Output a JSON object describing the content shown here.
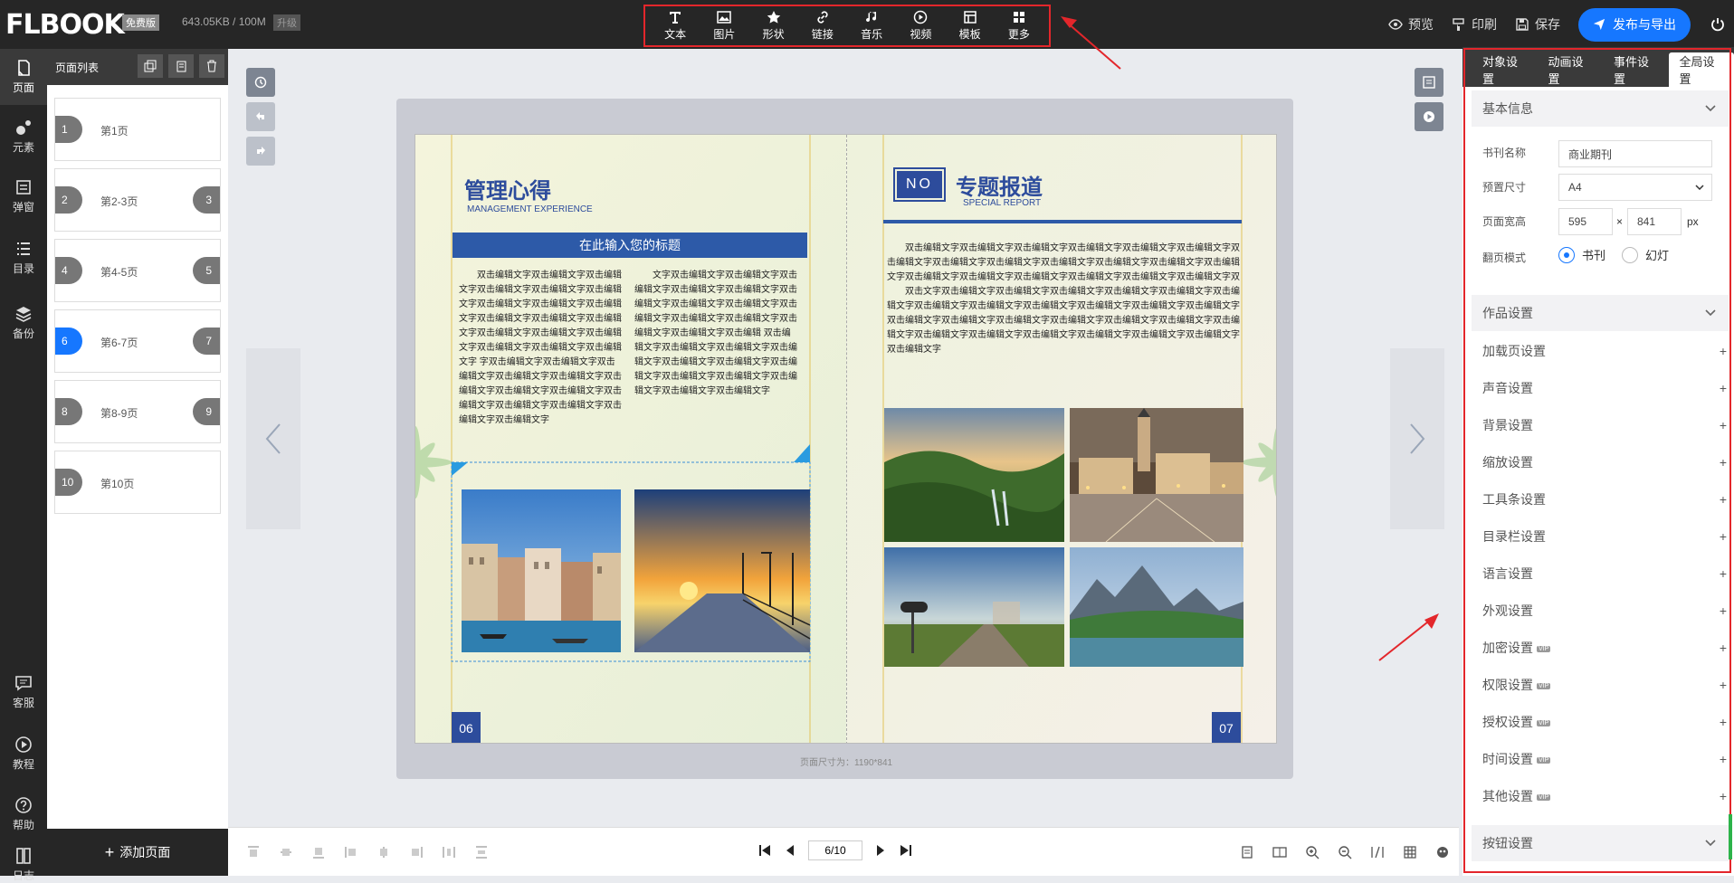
{
  "header": {
    "logo": "FLBOOK",
    "logo_mark": "®",
    "plan_badge": "免费版",
    "storage": "643.05KB / 100M",
    "upgrade": "升级",
    "tools": [
      {
        "label": "文本",
        "icon": "text-icon"
      },
      {
        "label": "图片",
        "icon": "image-icon"
      },
      {
        "label": "形状",
        "icon": "star-icon"
      },
      {
        "label": "链接",
        "icon": "link-icon"
      },
      {
        "label": "音乐",
        "icon": "music-icon"
      },
      {
        "label": "视频",
        "icon": "video-icon"
      },
      {
        "label": "模板",
        "icon": "template-icon"
      },
      {
        "label": "更多",
        "icon": "more-icon"
      }
    ],
    "preview": "预览",
    "print": "印刷",
    "save": "保存",
    "publish": "发布与导出"
  },
  "leftnav": {
    "items": [
      {
        "label": "页面",
        "icon": "page-icon"
      },
      {
        "label": "元素",
        "icon": "elements-icon"
      },
      {
        "label": "弹窗",
        "icon": "popup-icon"
      },
      {
        "label": "目录",
        "icon": "toc-icon"
      },
      {
        "label": "备份",
        "icon": "layers-icon"
      }
    ],
    "bottom": [
      {
        "label": "客服",
        "icon": "chat-icon"
      },
      {
        "label": "教程",
        "icon": "play-icon"
      },
      {
        "label": "帮助",
        "icon": "help-icon"
      },
      {
        "label": "日志",
        "icon": "log-icon"
      }
    ]
  },
  "pagelist": {
    "title": "页面列表",
    "pages": [
      {
        "num": "1",
        "label": "第1页",
        "right": ""
      },
      {
        "num": "2",
        "label": "第2-3页",
        "right": "3"
      },
      {
        "num": "4",
        "label": "第4-5页",
        "right": "5"
      },
      {
        "num": "6",
        "label": "第6-7页",
        "right": "7",
        "active": true
      },
      {
        "num": "8",
        "label": "第8-9页",
        "right": "9"
      },
      {
        "num": "10",
        "label": "第10页",
        "right": ""
      }
    ],
    "add_page": "添加页面"
  },
  "book": {
    "left": {
      "title": "管理心得",
      "subtitle": "MANAGEMENT EXPERIENCE",
      "bar_title": "在此输入您的标题",
      "col1": "双击编辑文字双击编辑文字双击编辑文字双击编辑文字双击编辑文字双击编辑文字双击编辑文字双击编辑文字双击编辑文字双击编辑文字双击编辑文字双击编辑文字双击编辑文字双击编辑文字双击编辑文字双击编辑文字双击编辑文字双击编辑文字 字双击编辑文字双击编辑文字双击编辑文字双击编辑文字双击编辑文字双击编辑文字双击编辑文字双击编辑文字双击编辑文字双击编辑文字双击编辑文字双击编辑文字双击编辑文字",
      "col2": "文字双击编辑文字双击编辑文字双击编辑文字双击编辑文字双击编辑文字双击编辑文字双击编辑文字双击编辑文字双击编辑文字双击编辑文字双击编辑文字双击编辑文字双击编辑文字双击编辑 双击编辑文字双击编辑文字双击编辑文字双击编辑文字双击编辑文字双击编辑文字双击编辑文字双击编辑文字双击编辑文字双击编辑文字双击编辑文字双击编辑文字",
      "page_num": "06"
    },
    "right": {
      "no_label": "NO",
      "title": "专题报道",
      "subtitle": "SPECIAL REPORT",
      "para1": "双击编辑文字双击编辑文字双击编辑文字双击编辑文字双击编辑文字双击编辑文字双击编辑文字双击编辑文字双击编辑文字双击编辑文字双击编辑文字双击编辑文字双击编辑文字双击编辑文字双击编辑文字双击编辑文字双击编辑文字双击编辑文字双击编辑文字双击编辑文字双击编辑文字双击编辑文字双击编辑文字双击编辑文字双击编辑文字 双击编辑文字双击编辑文字双击编辑文字双击编辑文字双击编辑文字双击编辑文字",
      "para2": "双击文字双击编辑文字双击编辑文字双击编辑文字双击编辑文字双击编辑文字双击编辑文字双击编辑文字双击编辑文字双击编辑文字双击编辑文字双击编辑文字双击编辑文字双击编辑文字双击编辑文字双击编辑文字双击编辑文字双击编辑文字双击编辑文字双击编辑文字双击编辑文字双击编辑文字双击编辑文字双击编辑文字双击编辑文字双击编辑文字双击编辑文字",
      "page_num": "07"
    },
    "page_size": "页面尺寸为：1190*841"
  },
  "pager": {
    "value": "6/10"
  },
  "rpanel": {
    "tabs": [
      "对象设置",
      "动画设置",
      "事件设置",
      "全局设置"
    ],
    "basic": {
      "title": "基本信息",
      "name_label": "书刊名称",
      "name_value": "商业期刊",
      "size_label": "预置尺寸",
      "size_value": "A4",
      "wh_label": "页面宽高",
      "width": "595",
      "times": "×",
      "height": "841",
      "unit": "px",
      "flip_label": "翻页模式",
      "flip_book": "书刊",
      "flip_slide": "幻灯"
    },
    "work_title": "作品设置",
    "settings": [
      {
        "label": "加载页设置",
        "vip": ""
      },
      {
        "label": "声音设置",
        "vip": ""
      },
      {
        "label": "背景设置",
        "vip": ""
      },
      {
        "label": "缩放设置",
        "vip": ""
      },
      {
        "label": "工具条设置",
        "vip": ""
      },
      {
        "label": "目录栏设置",
        "vip": ""
      },
      {
        "label": "语言设置",
        "vip": ""
      },
      {
        "label": "外观设置",
        "vip": ""
      },
      {
        "label": "加密设置",
        "vip": "VIP"
      },
      {
        "label": "权限设置",
        "vip": "VIP"
      },
      {
        "label": "授权设置",
        "vip": "VIP"
      },
      {
        "label": "时间设置",
        "vip": "VIP"
      },
      {
        "label": "其他设置",
        "vip": "VIP"
      }
    ],
    "button_title": "按钮设置"
  }
}
